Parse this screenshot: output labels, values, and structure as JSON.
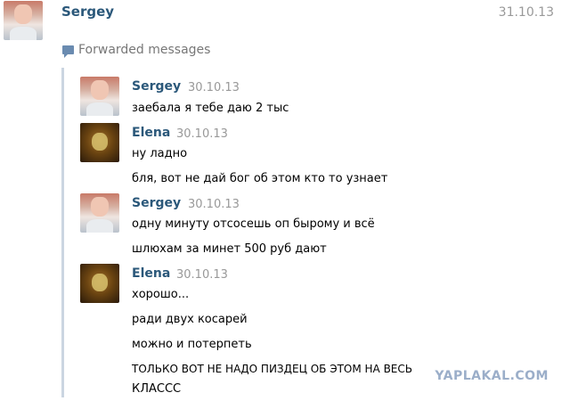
{
  "header": {
    "sender_name": "Sergey",
    "date": "31.10.13"
  },
  "forwarded": {
    "label": "Forwarded messages",
    "icon": "message-icon"
  },
  "messages": [
    {
      "author": "Sergey",
      "date": "30.10.13",
      "lines": [
        "заебала я тебе даю 2 тыс"
      ]
    },
    {
      "author": "Elena",
      "date": "30.10.13",
      "lines": [
        "ну ладно",
        "бля, вот не дай бог об этом кто то узнает"
      ]
    },
    {
      "author": "Sergey",
      "date": "30.10.13",
      "lines": [
        "одну минуту отсосешь оп бырому и всё",
        "шлюхам за минет 500 руб дают"
      ]
    },
    {
      "author": "Elena",
      "date": "30.10.13",
      "lines": [
        "хорошо...",
        "ради двух косарей",
        "можно и потерпеть",
        "ТОЛЬКО ВОТ НЕ НАДО ПИЗДЕЦ ОБ ЭТОМ НА ВЕСЬ",
        "КЛАССС"
      ]
    }
  ],
  "watermark": "YAPLAKAL.COM"
}
